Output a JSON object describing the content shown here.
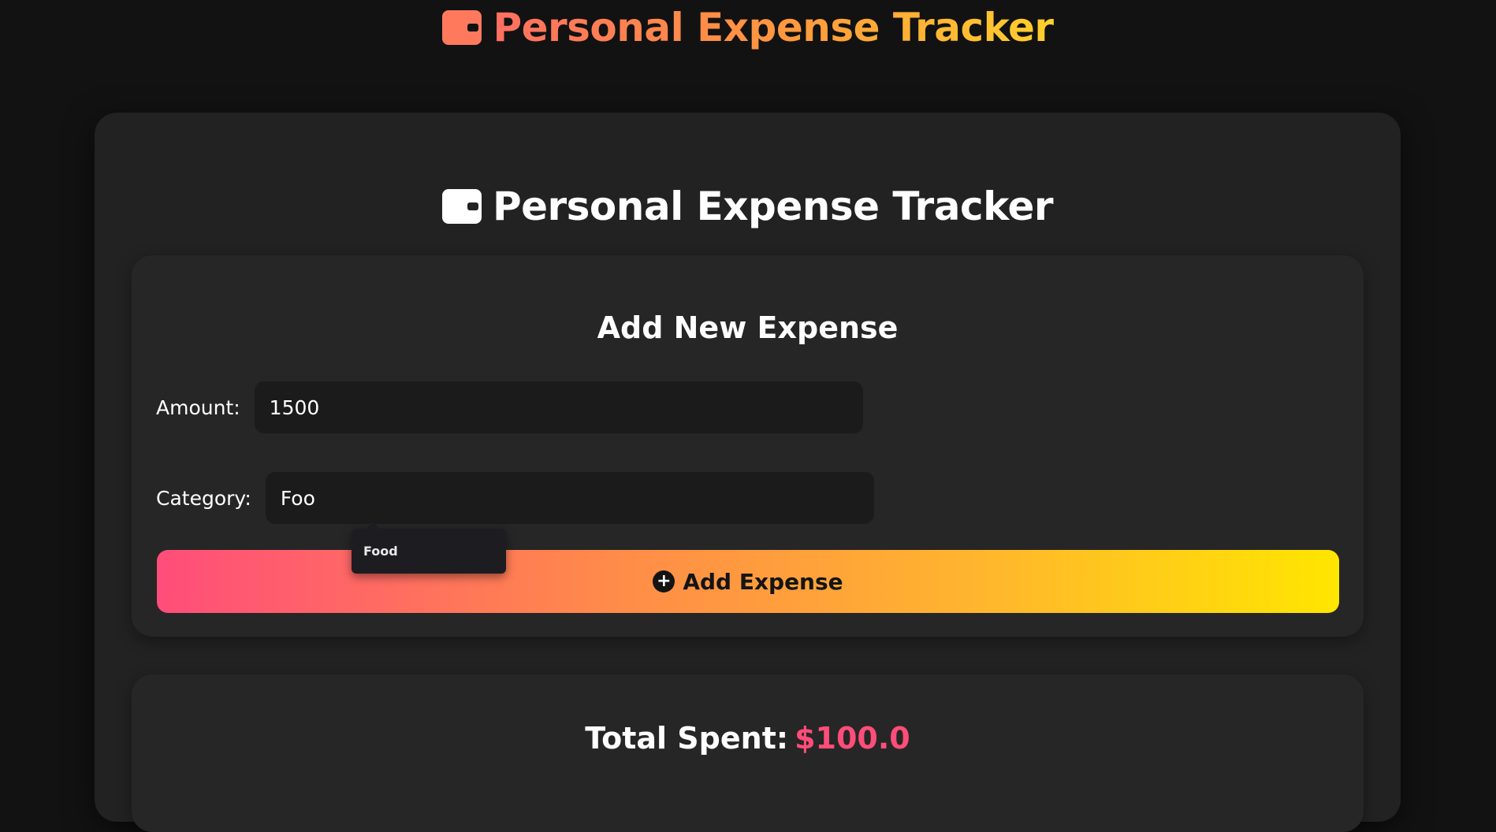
{
  "header": {
    "title": "Personal Expense Tracker",
    "icon": "wallet-icon",
    "gradient": [
      "#ff6f61",
      "#ff9a3c",
      "#ffd02b"
    ]
  },
  "main": {
    "title": "Personal Expense Tracker",
    "icon": "wallet-icon"
  },
  "form": {
    "title": "Add New Expense",
    "amount_label": "Amount:",
    "amount_value": "1500",
    "category_label": "Category:",
    "category_value": "Foo",
    "suggestions": [
      "Food"
    ],
    "button_label": "Add Expense",
    "button_icon": "plus-circle-icon"
  },
  "summary": {
    "label": "Total Spent:",
    "value": "$100.0",
    "accent": "#ff4d7a"
  }
}
